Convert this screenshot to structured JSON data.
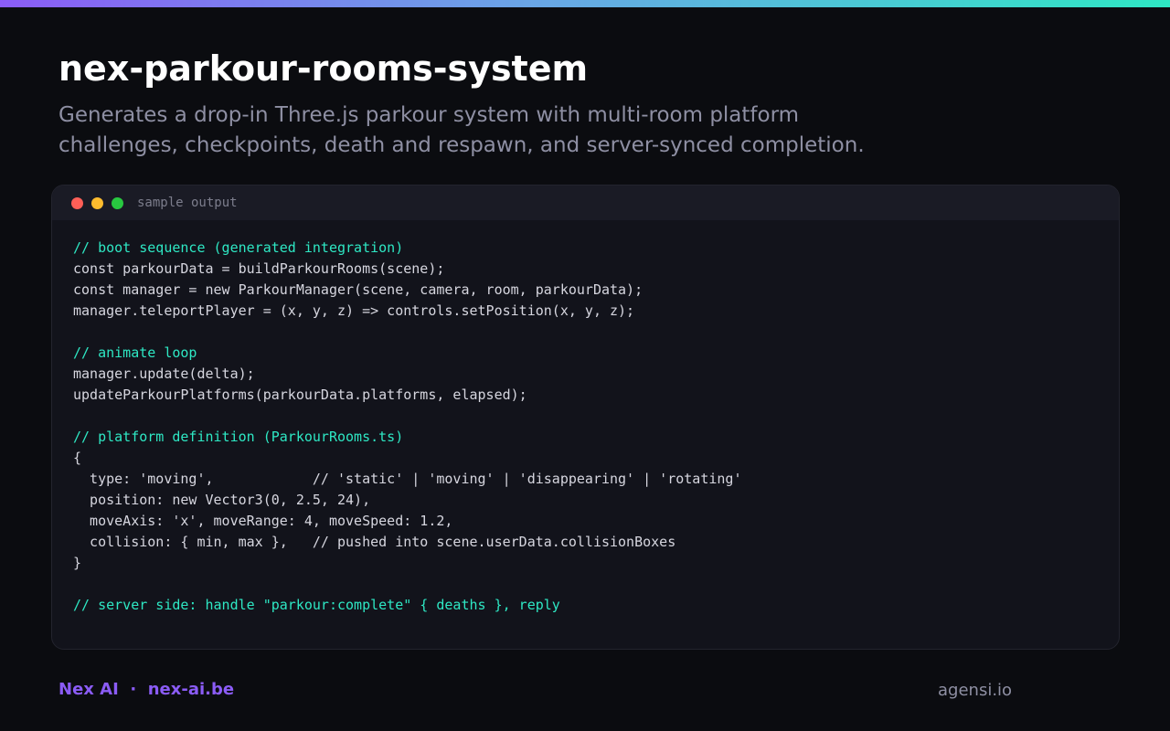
{
  "colors": {
    "background": "#0b0c10",
    "accent_purple": "#8b5cf6",
    "accent_teal": "#2ee8c4",
    "code_background": "#12131b",
    "code_header_background": "#1a1b25"
  },
  "header": {
    "title": "nex-parkour-rooms-system",
    "subtitle_lines": [
      "Generates a drop-in Three.js parkour system with multi-room platform",
      "challenges, checkpoints, death and respawn, and server-synced completion."
    ]
  },
  "code_window": {
    "label": "sample output",
    "lines": [
      {
        "text": "// boot sequence (generated integration)",
        "kind": "comment"
      },
      {
        "text": "const parkourData = buildParkourRooms(scene);",
        "kind": "code"
      },
      {
        "text": "const manager = new ParkourManager(scene, camera, room, parkourData);",
        "kind": "code"
      },
      {
        "text": "manager.teleportPlayer = (x, y, z) => controls.setPosition(x, y, z);",
        "kind": "code"
      },
      {
        "text": "",
        "kind": "blank"
      },
      {
        "text": "// animate loop",
        "kind": "comment"
      },
      {
        "text": "manager.update(delta);",
        "kind": "code"
      },
      {
        "text": "updateParkourPlatforms(parkourData.platforms, elapsed);",
        "kind": "code"
      },
      {
        "text": "",
        "kind": "blank"
      },
      {
        "text": "// platform definition (ParkourRooms.ts)",
        "kind": "comment"
      },
      {
        "text": "{",
        "kind": "code"
      },
      {
        "text": "  type: 'moving',            // 'static' | 'moving' | 'disappearing' | 'rotating'",
        "kind": "code"
      },
      {
        "text": "  position: new Vector3(0, 2.5, 24),",
        "kind": "code"
      },
      {
        "text": "  moveAxis: 'x', moveRange: 4, moveSpeed: 1.2,",
        "kind": "code"
      },
      {
        "text": "  collision: { min, max },   // pushed into scene.userData.collisionBoxes",
        "kind": "code"
      },
      {
        "text": "}",
        "kind": "code"
      },
      {
        "text": "",
        "kind": "blank"
      },
      {
        "text": "// server side: handle \"parkour:complete\" { deaths }, reply",
        "kind": "comment"
      }
    ]
  },
  "footer": {
    "brand": "Nex AI",
    "separator": "·",
    "site": "nex-ai.be",
    "right_text": "agensi.io"
  }
}
